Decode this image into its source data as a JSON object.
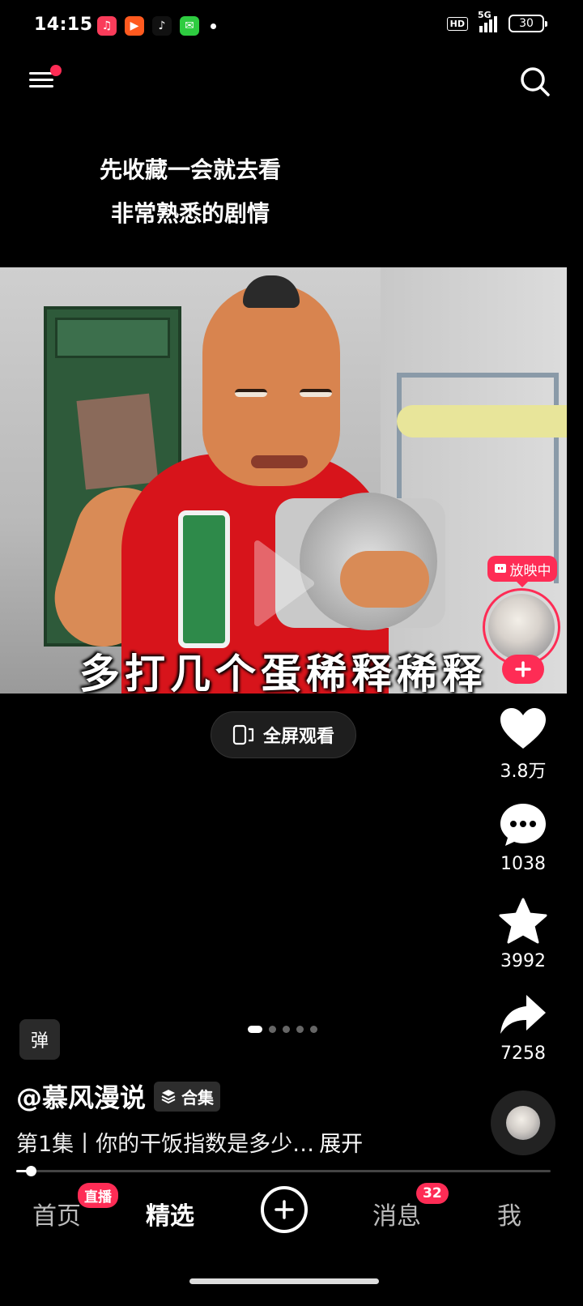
{
  "status_bar": {
    "time": "14:15",
    "apps": [
      {
        "icon": "music-app-icon",
        "color": "#fa3c5a",
        "glyph": "♫"
      },
      {
        "icon": "video-app-icon",
        "color": "#ff5a1f",
        "glyph": "▶"
      },
      {
        "icon": "tiktok-app-icon",
        "color": "#111111",
        "glyph": "♪"
      },
      {
        "icon": "chat-app-icon",
        "color": "#2ecc40",
        "glyph": "✉"
      }
    ],
    "hd": "HD",
    "network": "5G",
    "battery": "30"
  },
  "captions": {
    "line1": "先收藏一会就去看",
    "line2": "非常熟悉的剧情"
  },
  "video": {
    "subtitle": "多打几个蛋稀释稀释"
  },
  "live": {
    "tag": "放映中"
  },
  "fullscreen": {
    "label": "全屏观看"
  },
  "actions": {
    "likes": "3.8万",
    "comments": "1038",
    "favorites": "3992",
    "shares": "7258"
  },
  "info": {
    "fast_badge": "弹",
    "author": "@慕风漫说",
    "collection": "合集",
    "description": "第1集丨你的干饭指数是多少…",
    "expand": "展开",
    "progress": 0.027,
    "page_index": 0,
    "page_count": 5
  },
  "nav": {
    "home": "首页",
    "live_badge": "直播",
    "featured": "精选",
    "messages": "消息",
    "messages_badge": "32",
    "me": "我"
  },
  "colors": {
    "accent": "#fe2c55",
    "background": "#000000"
  }
}
